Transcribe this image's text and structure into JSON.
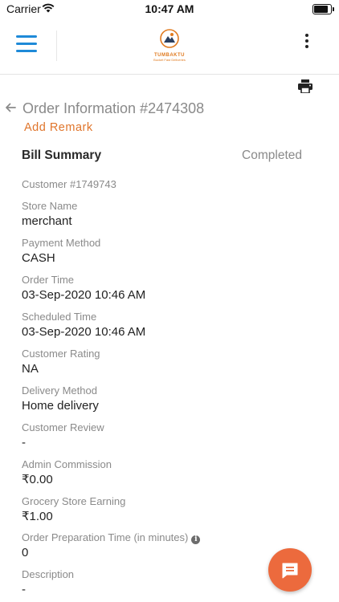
{
  "status_bar": {
    "carrier": "Carrier",
    "time": "10:47 AM"
  },
  "header": {
    "logo_name": "TUMBAKTU",
    "logo_tagline": "Bucket Fast Deliveries",
    "menu_icon": "hamburger-menu-icon",
    "more_icon": "more-vertical-icon"
  },
  "order": {
    "title": "Order Information #2474308",
    "add_remark": "Add Remark",
    "bill_summary": "Bill Summary",
    "status": "Completed",
    "customer_id": "Customer #1749743"
  },
  "fields": [
    {
      "label": "Store Name",
      "value": "merchant"
    },
    {
      "label": "Payment Method",
      "value": "CASH"
    },
    {
      "label": "Order Time",
      "value": "03-Sep-2020 10:46 AM"
    },
    {
      "label": "Scheduled Time",
      "value": "03-Sep-2020 10:46 AM"
    },
    {
      "label": "Customer Rating",
      "value": "NA"
    },
    {
      "label": "Delivery Method",
      "value": "Home delivery"
    },
    {
      "label": "Customer Review",
      "value": "-"
    },
    {
      "label": "Admin Commission",
      "value": "₹0.00"
    },
    {
      "label": "Grocery Store Earning",
      "value": "₹1.00"
    },
    {
      "label": "Order Preparation Time (in minutes)",
      "value": "0"
    },
    {
      "label": "Description",
      "value": "-"
    }
  ],
  "colors": {
    "accent": "#e0752b",
    "menu_blue": "#1e8ad8",
    "fab": "#ec6a3d"
  }
}
